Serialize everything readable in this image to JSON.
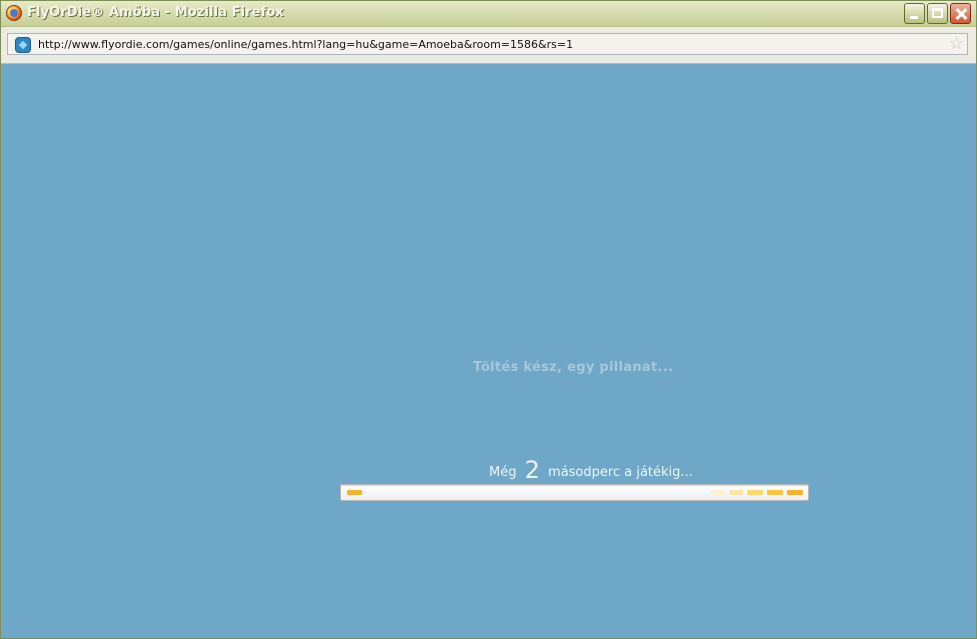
{
  "window": {
    "title": "FlyOrDie® Amőba - Mozilla Firefox",
    "icon": "firefox-icon"
  },
  "addressbar": {
    "url": "http://www.flyordie.com/games/online/games.html?lang=hu&game=Amoeba&room=1586&rs=1",
    "site_icon": "flyordie-site-icon",
    "bookmark_icon": "star-icon"
  },
  "content": {
    "loading_message": "Töltés kész, egy pillanat...",
    "countdown_prefix": "Még",
    "countdown_number": "2",
    "countdown_suffix": "másodperc a játékig...",
    "background_color": "#6ea7c8"
  },
  "progress": {
    "accent_color": "#f7b225"
  }
}
